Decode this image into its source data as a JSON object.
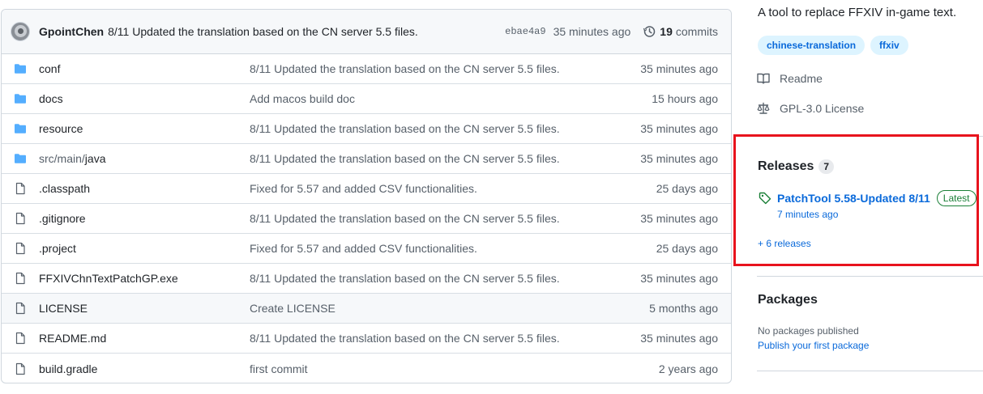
{
  "commit": {
    "author": "GpointChen",
    "message": "8/11 Updated the translation based on the CN server 5.5 files.",
    "sha": "ebae4a9",
    "time": "35 minutes ago",
    "count": "19",
    "count_label": "commits"
  },
  "files": [
    {
      "name": "conf",
      "type": "dir",
      "message": "8/11 Updated the translation based on the CN server 5.5 files.",
      "age": "35 minutes ago"
    },
    {
      "name": "docs",
      "type": "dir",
      "message": "Add macos build doc",
      "age": "15 hours ago"
    },
    {
      "name": "resource",
      "type": "dir",
      "message": "8/11 Updated the translation based on the CN server 5.5 files.",
      "age": "35 minutes ago"
    },
    {
      "name_prefix": "src/main/",
      "name": "java",
      "type": "dir",
      "message": "8/11 Updated the translation based on the CN server 5.5 files.",
      "age": "35 minutes ago"
    },
    {
      "name": ".classpath",
      "type": "file",
      "message": "Fixed for 5.57 and added CSV functionalities.",
      "age": "25 days ago"
    },
    {
      "name": ".gitignore",
      "type": "file",
      "message": "8/11 Updated the translation based on the CN server 5.5 files.",
      "age": "35 minutes ago"
    },
    {
      "name": ".project",
      "type": "file",
      "message": "Fixed for 5.57 and added CSV functionalities.",
      "age": "25 days ago"
    },
    {
      "name": "FFXIVChnTextPatchGP.exe",
      "type": "file",
      "message": "8/11 Updated the translation based on the CN server 5.5 files.",
      "age": "35 minutes ago"
    },
    {
      "name": "LICENSE",
      "type": "file",
      "message": "Create LICENSE",
      "age": "5 months ago"
    },
    {
      "name": "README.md",
      "type": "file",
      "message": "8/11 Updated the translation based on the CN server 5.5 files.",
      "age": "35 minutes ago"
    },
    {
      "name": "build.gradle",
      "type": "file",
      "message": "first commit",
      "age": "2 years ago"
    }
  ],
  "about": {
    "description": "A tool to replace FFXIV in-game text.",
    "topics": [
      "chinese-translation",
      "ffxiv"
    ],
    "readme": "Readme",
    "license": "GPL-3.0 License"
  },
  "releases": {
    "title": "Releases",
    "count": "7",
    "latest_name": "PatchTool 5.58-Updated 8/11",
    "latest_badge": "Latest",
    "latest_time": "7 minutes ago",
    "more": "+ 6 releases"
  },
  "packages": {
    "title": "Packages",
    "none": "No packages published",
    "publish_link": "Publish your first package"
  },
  "colors": {
    "link": "#0969da",
    "folder": "#54aeff",
    "highlight_box": "#e8131d",
    "latest_badge": "#1a7f37"
  }
}
